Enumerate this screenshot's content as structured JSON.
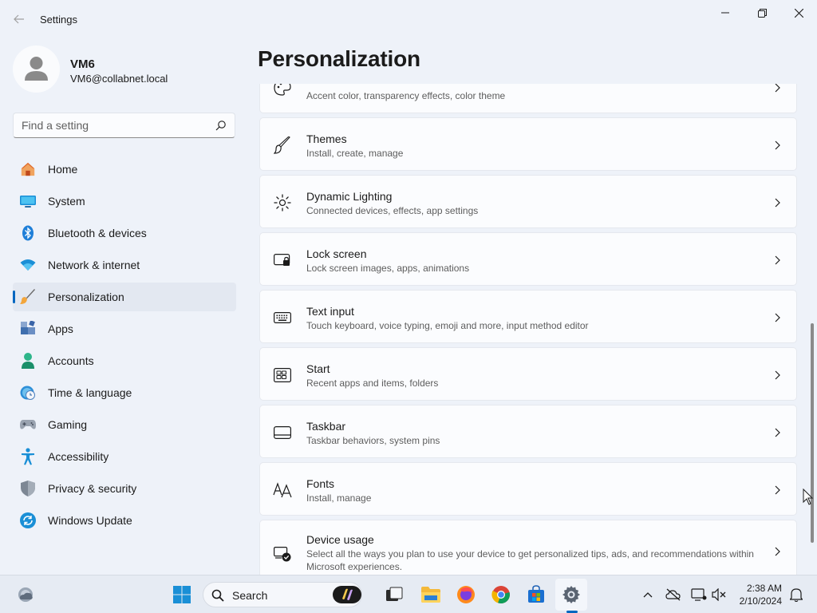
{
  "window": {
    "title": "Settings"
  },
  "profile": {
    "name": "VM6",
    "email": "VM6@collabnet.local"
  },
  "search": {
    "placeholder": "Find a setting"
  },
  "nav": {
    "items": [
      {
        "label": "Home",
        "icon": "home-icon"
      },
      {
        "label": "System",
        "icon": "monitor-icon"
      },
      {
        "label": "Bluetooth & devices",
        "icon": "bluetooth-icon"
      },
      {
        "label": "Network & internet",
        "icon": "wifi-icon"
      },
      {
        "label": "Personalization",
        "icon": "brush-icon",
        "active": true
      },
      {
        "label": "Apps",
        "icon": "apps-icon"
      },
      {
        "label": "Accounts",
        "icon": "person-icon"
      },
      {
        "label": "Time & language",
        "icon": "globe-clock-icon"
      },
      {
        "label": "Gaming",
        "icon": "gamepad-icon"
      },
      {
        "label": "Accessibility",
        "icon": "accessibility-icon"
      },
      {
        "label": "Privacy & security",
        "icon": "shield-icon"
      },
      {
        "label": "Windows Update",
        "icon": "update-icon"
      }
    ]
  },
  "main": {
    "title": "Personalization",
    "cards": [
      {
        "title": "",
        "subtitle": "Accent color, transparency effects, color theme",
        "icon": "palette-icon"
      },
      {
        "title": "Themes",
        "subtitle": "Install, create, manage",
        "icon": "brush-icon"
      },
      {
        "title": "Dynamic Lighting",
        "subtitle": "Connected devices, effects, app settings",
        "icon": "lighting-icon"
      },
      {
        "title": "Lock screen",
        "subtitle": "Lock screen images, apps, animations",
        "icon": "lock-screen-icon"
      },
      {
        "title": "Text input",
        "subtitle": "Touch keyboard, voice typing, emoji and more, input method editor",
        "icon": "keyboard-icon"
      },
      {
        "title": "Start",
        "subtitle": "Recent apps and items, folders",
        "icon": "start-icon"
      },
      {
        "title": "Taskbar",
        "subtitle": "Taskbar behaviors, system pins",
        "icon": "taskbar-icon"
      },
      {
        "title": "Fonts",
        "subtitle": "Install, manage",
        "icon": "fonts-icon"
      },
      {
        "title": "Device usage",
        "subtitle": "Select all the ways you plan to use your device to get personalized tips, ads, and recommendations within",
        "subtitle2": "Microsoft experiences.",
        "icon": "device-usage-icon"
      }
    ]
  },
  "taskbar": {
    "search_label": "Search",
    "time": "2:38 AM",
    "date": "2/10/2024"
  }
}
